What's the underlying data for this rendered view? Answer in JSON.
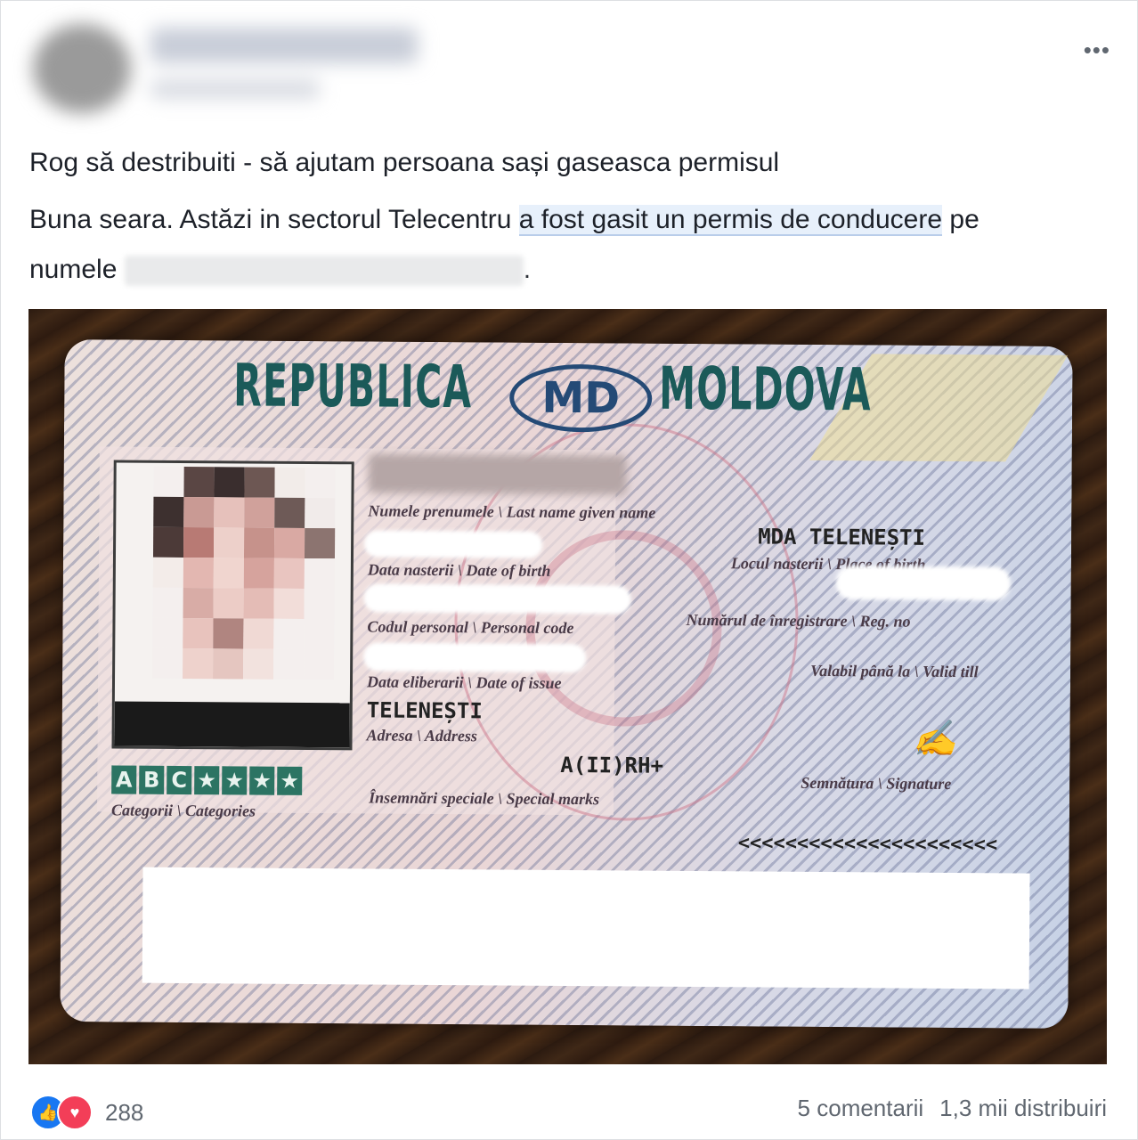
{
  "post": {
    "menu_icon": "more-options-icon",
    "title_line": "Rog să destribuiti - să ajutam persoana sași gaseasca permisul",
    "body_before": "Buna seara. Astăzi in sectorul Telecentru ",
    "body_link": "a fost gasit un permis de conducere",
    "body_mid": " pe numele ",
    "body_after": "."
  },
  "card": {
    "header_left": "REPUBLICA",
    "logo": "MD",
    "header_right": "MOLDOVA",
    "label_name": "Numele prenumele \\ Last name given name",
    "label_dob": "Data nasterii \\ Date of birth",
    "label_personal_code": "Codul personal \\ Personal code",
    "label_issue": "Data eliberarii \\ Date of issue",
    "address_value": "TELENEȘTI",
    "label_address": "Adresa \\ Address",
    "birthplace_value": "MDA TELENEȘTI",
    "label_birthplace": "Locul nasterii \\ Place of birth",
    "label_reg": "Numărul de înregistrare \\ Reg. no",
    "label_valid": "Valabil până la \\ Valid till",
    "blood_value": "A(II)RH+",
    "label_special": "Însemnări speciale \\ Special marks",
    "label_signature": "Semnătura \\ Signature",
    "categories": [
      "A",
      "B",
      "C",
      "★",
      "★",
      "★",
      "★"
    ],
    "label_categories": "Categorii \\ Categories",
    "mrz_partial": "<<<<<<<<<<<<<<<<<<<<<<"
  },
  "footer": {
    "reaction_icons": [
      "like-icon",
      "love-icon"
    ],
    "reaction_count": "288",
    "comments": "5 comentarii",
    "shares": "1,3 mii distribuiri"
  },
  "colors": {
    "link_highlight": "#e7f0fb",
    "like": "#1877f2",
    "love": "#f33e58",
    "card_title": "#1b5a59",
    "category_box": "#2c7463"
  }
}
